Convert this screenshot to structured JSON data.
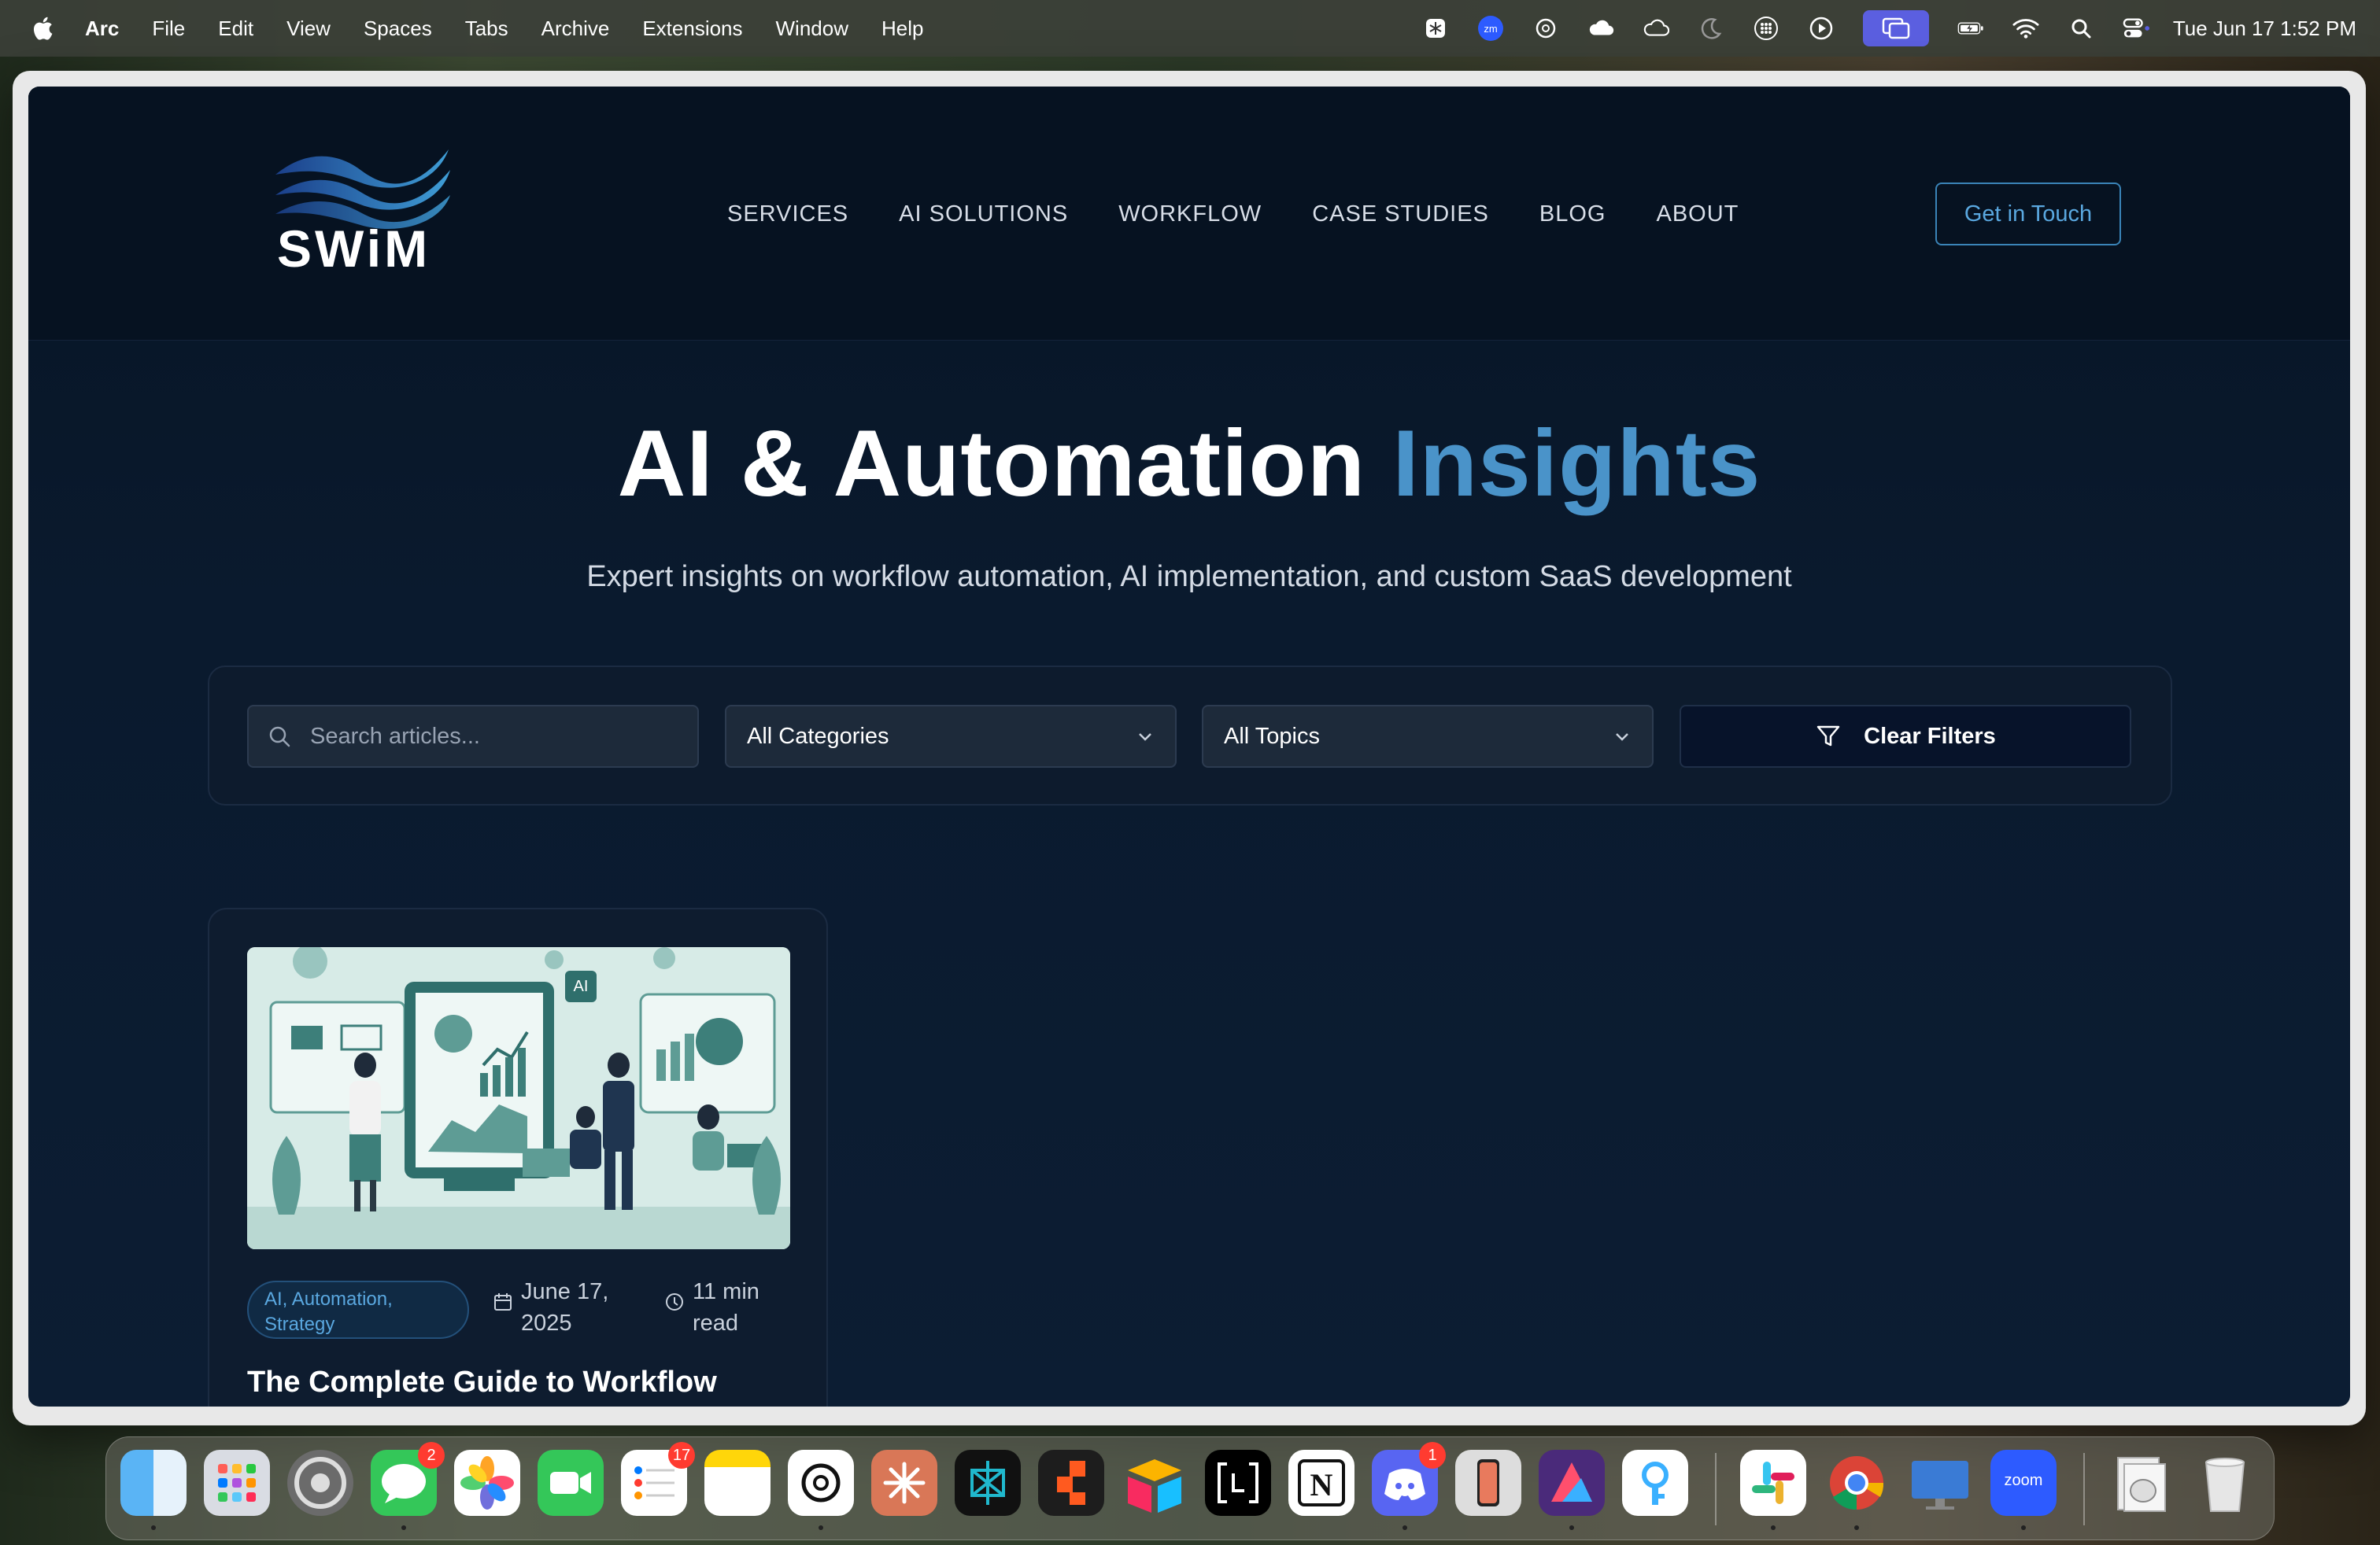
{
  "menubar": {
    "app": "Arc",
    "items": [
      "File",
      "Edit",
      "View",
      "Spaces",
      "Tabs",
      "Archive",
      "Extensions",
      "Window",
      "Help"
    ],
    "clock": "Tue Jun 17  1:52 PM"
  },
  "site": {
    "logo_text": "SWiM",
    "nav": [
      "SERVICES",
      "AI SOLUTIONS",
      "WORKFLOW",
      "CASE STUDIES",
      "BLOG",
      "ABOUT"
    ],
    "cta": "Get in Touch"
  },
  "hero": {
    "title_main": "AI & Automation ",
    "title_accent": "Insights",
    "subtitle": "Expert insights on workflow automation, AI implementation, and custom SaaS development"
  },
  "filters": {
    "search_placeholder": "Search articles...",
    "category": "All Categories",
    "topic": "All Topics",
    "clear": "Clear Filters"
  },
  "article": {
    "tags": "AI, Automation, Strategy",
    "date": "June 17, 2025",
    "read": "11 min read",
    "title": "The Complete Guide to Workflow"
  },
  "dock": {
    "badges": {
      "messages": "2",
      "reminders": "17",
      "discord": "1"
    },
    "zoom_label": "zoom"
  },
  "colors": {
    "accent": "#4a93c9",
    "background": "#071424",
    "card": "#0e1c2f"
  }
}
